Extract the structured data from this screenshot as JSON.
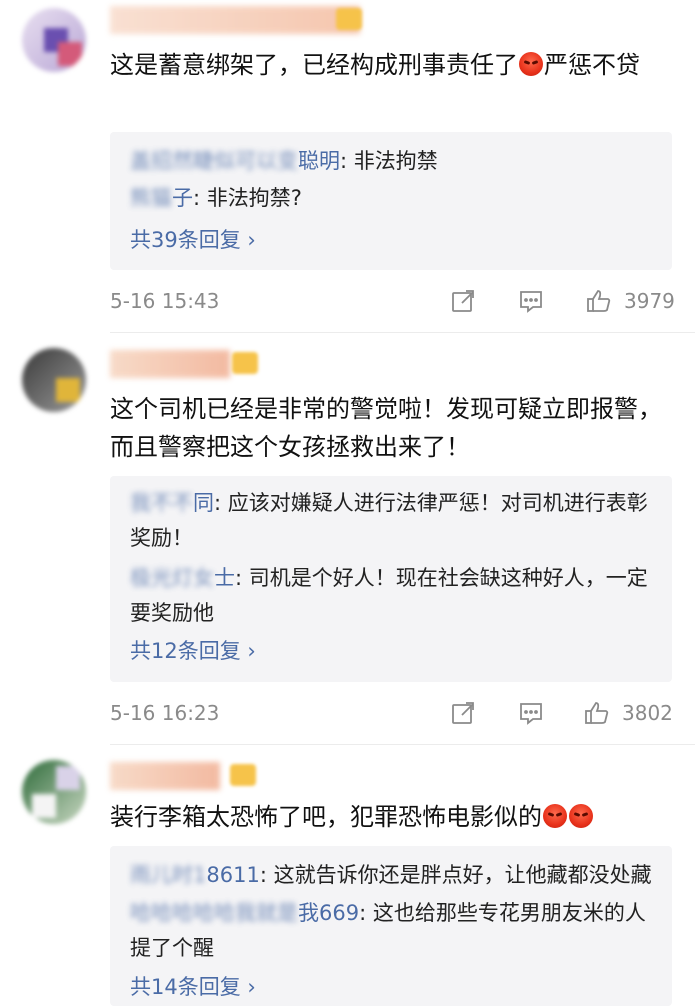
{
  "comments": [
    {
      "username": "",
      "text_before": "这是蓄意绑架了，已经构成刑事责任了",
      "text_after": "严惩不贷",
      "replies": [
        {
          "name_visible": "聪明",
          "text": ": 非法拘禁"
        },
        {
          "name_visible": "子",
          "text": ": 非法拘禁?"
        }
      ],
      "more_label": "共39条回复 ›",
      "time": "5-16 15:43",
      "like_count": "3979"
    },
    {
      "username": "",
      "text": "这个司机已经是非常的警觉啦！发现可疑立即报警，而且警察把这个女孩拯救出来了！",
      "replies": [
        {
          "name_visible": "同",
          "text": ": 应该对嫌疑人进行法律严惩！对司机进行表彰奖励！"
        },
        {
          "name_visible": "士",
          "text": ": 司机是个好人！现在社会缺这种好人，一定要奖励他"
        }
      ],
      "more_label": "共12条回复 ›",
      "time": "5-16 16:23",
      "like_count": "3802"
    },
    {
      "username": "",
      "text": "装行李箱太恐怖了吧，犯罪恐怖电影似的",
      "replies": [
        {
          "name_visible": "8611",
          "text": ": 这就告诉你还是胖点好，让他藏都没处藏"
        },
        {
          "name_visible": "我669",
          "text": ": 这也给那些专花男朋友米的人提了个醒"
        }
      ],
      "more_label": "共14条回复 ›"
    }
  ],
  "icons": {
    "share": "share-icon",
    "comment": "comment-icon",
    "like": "thumbs-up-icon",
    "emoji": "angry-emoji-icon"
  },
  "colors": {
    "link": "#4a6ba6",
    "meta": "#8a8a8a",
    "reply_bg": "#f4f4f6"
  }
}
